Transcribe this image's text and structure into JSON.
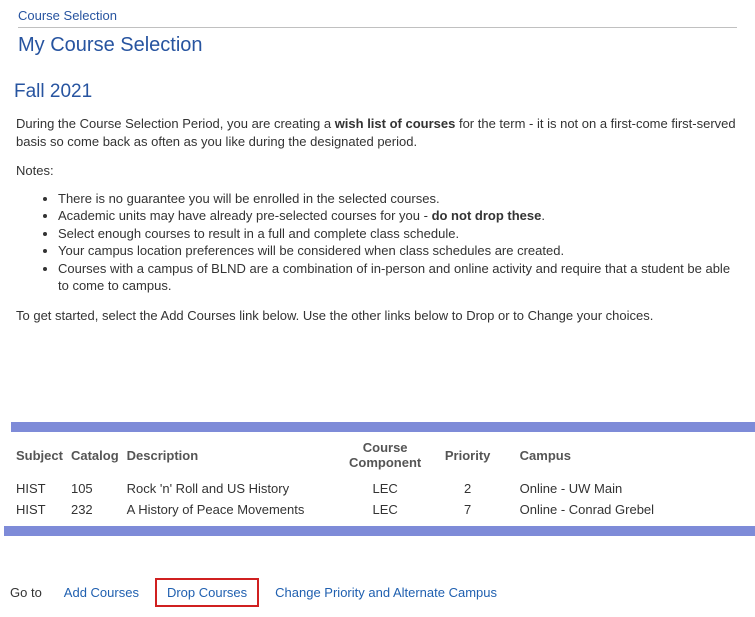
{
  "header": {
    "breadcrumb": "Course Selection",
    "title": "My Course Selection"
  },
  "term": "Fall 2021",
  "intro": {
    "before_bold": "During the Course Selection Period, you are creating a ",
    "bold": "wish list of courses",
    "after_bold": " for the term - it is not on a first-come first-served basis so come back as often as you like during the designated period."
  },
  "notes_label": "Notes:",
  "notes": [
    {
      "text": "There is no guarantee you will be enrolled in the selected courses."
    },
    {
      "before_bold": "Academic units may have already pre-selected courses for you - ",
      "bold": "do not drop these",
      "after_bold": "."
    },
    {
      "text": "Select enough courses to result in a full and complete class schedule."
    },
    {
      "text": "Your campus location preferences will be considered when class schedules are created."
    },
    {
      "text": "Courses with a campus of BLND are a combination of in-person and online activity and require that a student be able to come to campus."
    }
  ],
  "get_started": "To get started, select the Add Courses link below. Use the other links below to Drop or to Change your choices.",
  "table": {
    "headers": {
      "subject": "Subject",
      "catalog": "Catalog",
      "description": "Description",
      "component": "Course Component",
      "priority": "Priority",
      "campus": "Campus"
    },
    "rows": [
      {
        "subject": "HIST",
        "catalog": "105",
        "description": "Rock 'n' Roll and US History",
        "component": "LEC",
        "priority": "2",
        "campus": "Online - UW Main"
      },
      {
        "subject": "HIST",
        "catalog": "232",
        "description": "A History of Peace Movements",
        "component": "LEC",
        "priority": "7",
        "campus": "Online - Conrad Grebel"
      }
    ]
  },
  "footer": {
    "goto": "Go to",
    "add": "Add Courses",
    "drop": "Drop Courses",
    "change": "Change Priority and Alternate Campus"
  }
}
